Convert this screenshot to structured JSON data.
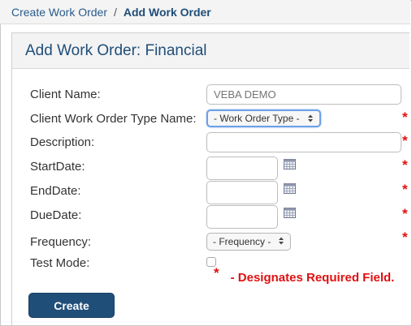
{
  "breadcrumb": {
    "parent": "Create Work Order",
    "separator": "/",
    "current": "Add Work Order"
  },
  "panel": {
    "title": "Add Work Order: Financial"
  },
  "form": {
    "client_name": {
      "label": "Client Name:",
      "placeholder": "VEBA DEMO"
    },
    "work_order_type": {
      "label": "Client Work Order Type Name:",
      "selected": "- Work Order Type -"
    },
    "description": {
      "label": "Description:"
    },
    "start_date": {
      "label": "StartDate:"
    },
    "end_date": {
      "label": "EndDate:"
    },
    "due_date": {
      "label": "DueDate:"
    },
    "frequency": {
      "label": "Frequency:",
      "selected": "- Frequency -"
    },
    "test_mode": {
      "label": "Test Mode:",
      "checked": false
    }
  },
  "required_marker": "*",
  "legend": {
    "marker": "*",
    "text": "- Designates Required Field."
  },
  "create_button": {
    "label": "Create"
  },
  "icons": {
    "calendar": "calendar-icon",
    "select_arrows": "updown-arrow-icon"
  },
  "colors": {
    "brand": "#1f4e79",
    "link": "#2a5b8c",
    "required": "#e01010",
    "focus_ring": "#6ea0e6"
  }
}
